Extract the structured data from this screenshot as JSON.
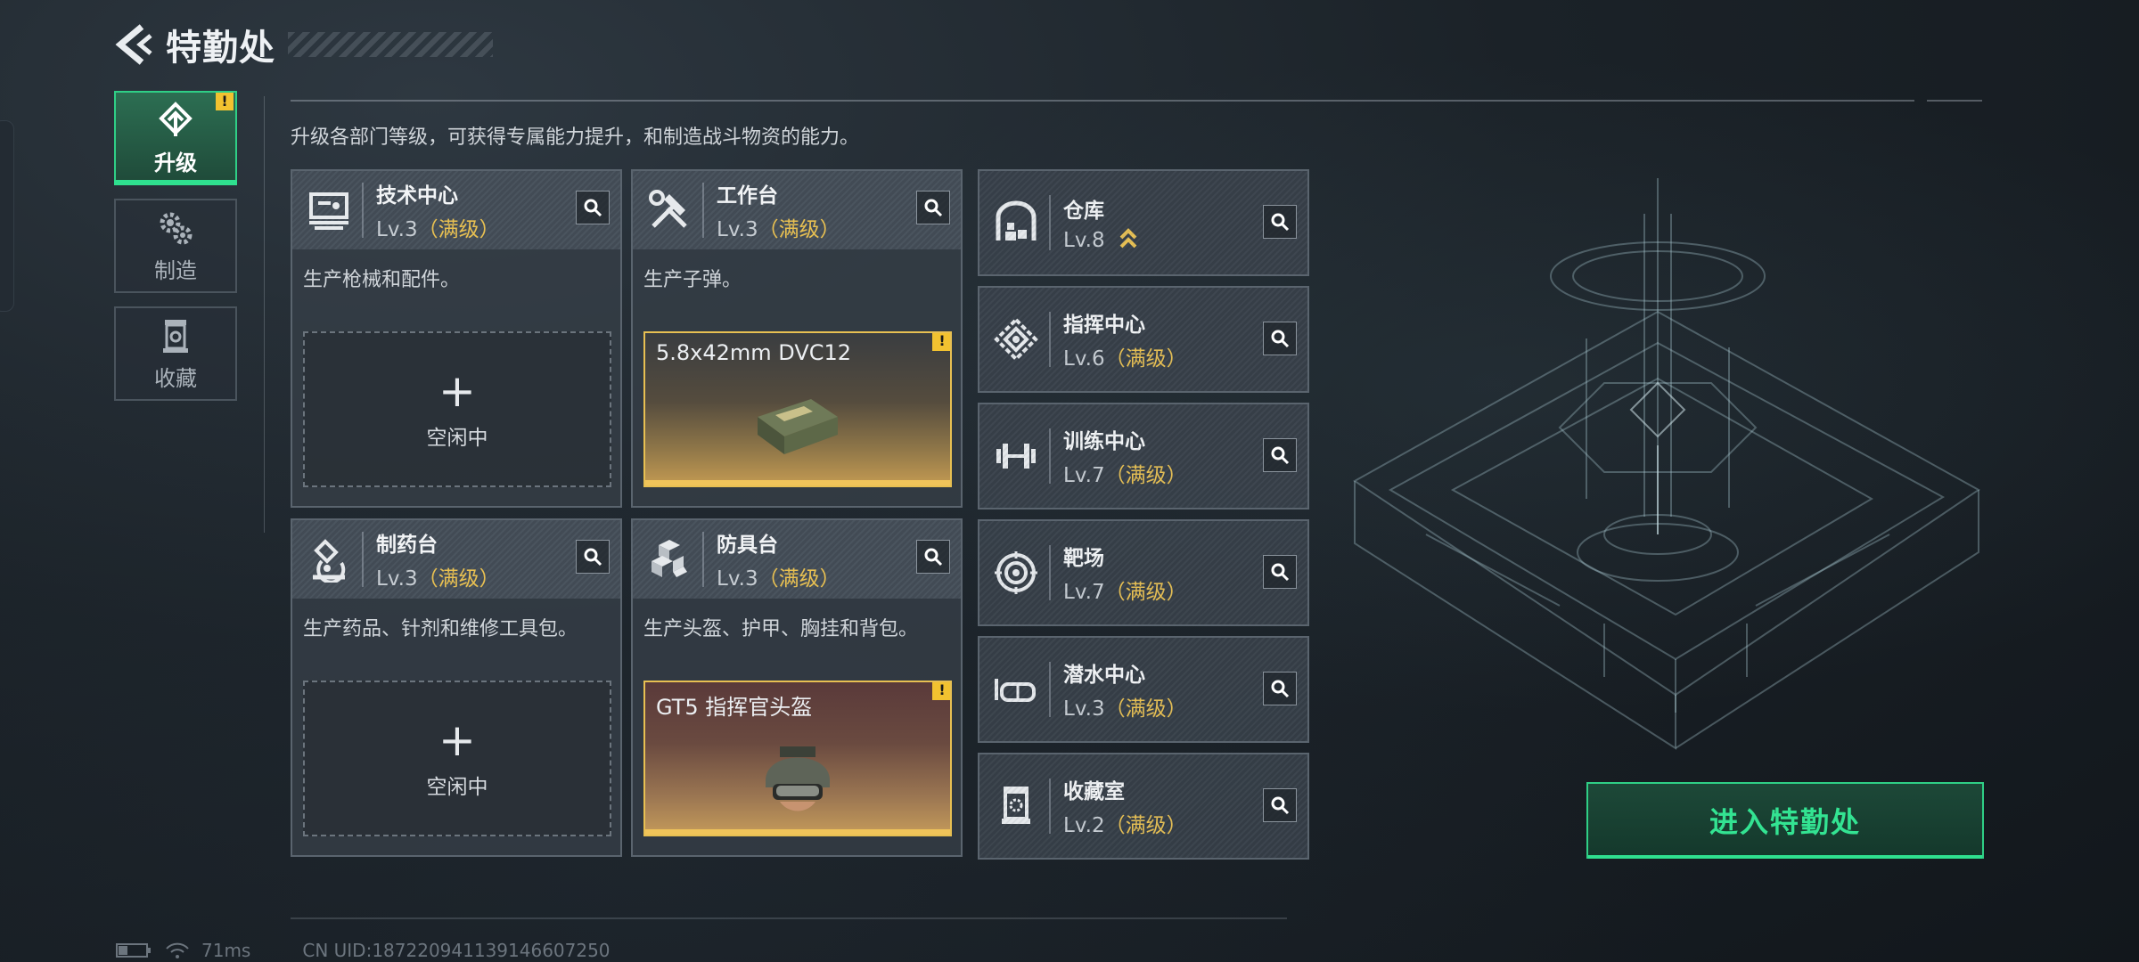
{
  "header": {
    "title": "特勤处"
  },
  "side_nav": [
    {
      "label": "升级",
      "active": true,
      "badge": "!",
      "icon": "upgrade-icon"
    },
    {
      "label": "制造",
      "active": false,
      "icon": "gears-icon"
    },
    {
      "label": "收藏",
      "active": false,
      "icon": "collection-icon"
    }
  ],
  "description": "升级各部门等级，可获得专属能力提升，和制造战斗物资的能力。",
  "max_tag": "（满级）",
  "large_cards": [
    {
      "name": "技术中心",
      "level": "Lv.3",
      "desc": "生产枪械和配件。",
      "slot": {
        "type": "idle",
        "plus": "+",
        "label": "空闲中"
      },
      "icon": "tech-center-icon"
    },
    {
      "name": "工作台",
      "level": "Lv.3",
      "desc": "生产子弹。",
      "slot": {
        "type": "producing",
        "item": "5.8x42mm DVC12",
        "badge": "!"
      },
      "icon": "hammer-wrench-icon"
    },
    {
      "name": "制药台",
      "level": "Lv.3",
      "desc": "生产药品、针剂和维修工具包。",
      "slot": {
        "type": "idle",
        "plus": "+",
        "label": "空闲中"
      },
      "icon": "microscope-icon"
    },
    {
      "name": "防具台",
      "level": "Lv.3",
      "desc": "生产头盔、护甲、胸挂和背包。",
      "slot": {
        "type": "producing",
        "item": "GT5 指挥官头盔",
        "badge": "!"
      },
      "icon": "armor-boxes-icon"
    }
  ],
  "small_cards": [
    {
      "name": "仓库",
      "level": "Lv.8",
      "upgradable": true,
      "icon": "warehouse-icon"
    },
    {
      "name": "指挥中心",
      "level": "Lv.6",
      "icon": "command-center-icon"
    },
    {
      "name": "训练中心",
      "level": "Lv.7",
      "icon": "dumbbell-icon"
    },
    {
      "name": "靶场",
      "level": "Lv.7",
      "icon": "target-icon"
    },
    {
      "name": "潜水中心",
      "level": "Lv.3",
      "icon": "diving-mask-icon"
    },
    {
      "name": "收藏室",
      "level": "Lv.2",
      "icon": "collection-room-icon"
    }
  ],
  "enter_button": {
    "label": "进入特勤处"
  },
  "footer": {
    "ping": "71ms",
    "uid": "CN UID:187220941139146607250"
  },
  "colors": {
    "accent_green": "#2fcf86",
    "max_level_gold": "#e8c052",
    "badge_yellow": "#f2c230"
  }
}
